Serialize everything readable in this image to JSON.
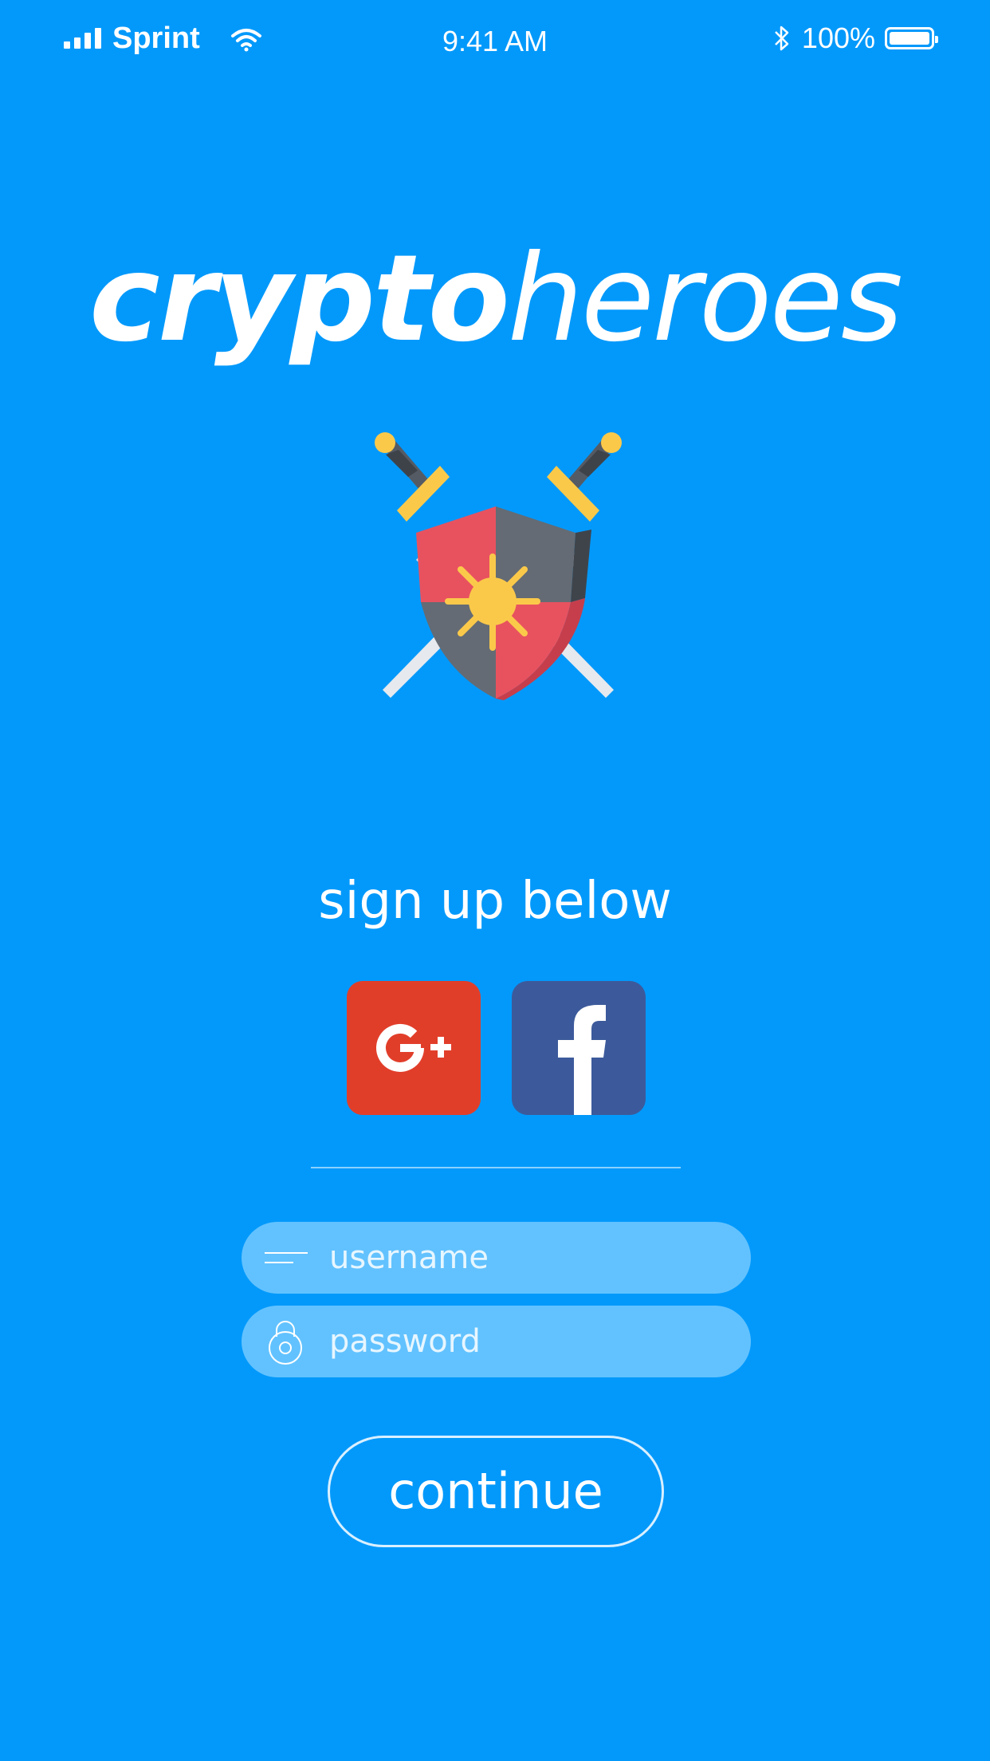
{
  "status_bar": {
    "carrier": "Sprint",
    "time": "9:41 AM",
    "battery": "100%",
    "icons": [
      "signal-icon",
      "wifi-icon",
      "bluetooth-icon",
      "battery-icon"
    ]
  },
  "logo": {
    "bold_part": "crypto",
    "light_part": "heroes",
    "emblem_icon": "shield-swords-icon"
  },
  "signup": {
    "heading": "sign up below",
    "google_label": "G+",
    "facebook_label": "f"
  },
  "form": {
    "username_placeholder": "username",
    "password_placeholder": "password",
    "continue_label": "continue"
  },
  "colors": {
    "background": "#0399fb",
    "field": "#62c2ff",
    "google": "#e13e2a",
    "facebook": "#3c5a9b"
  }
}
